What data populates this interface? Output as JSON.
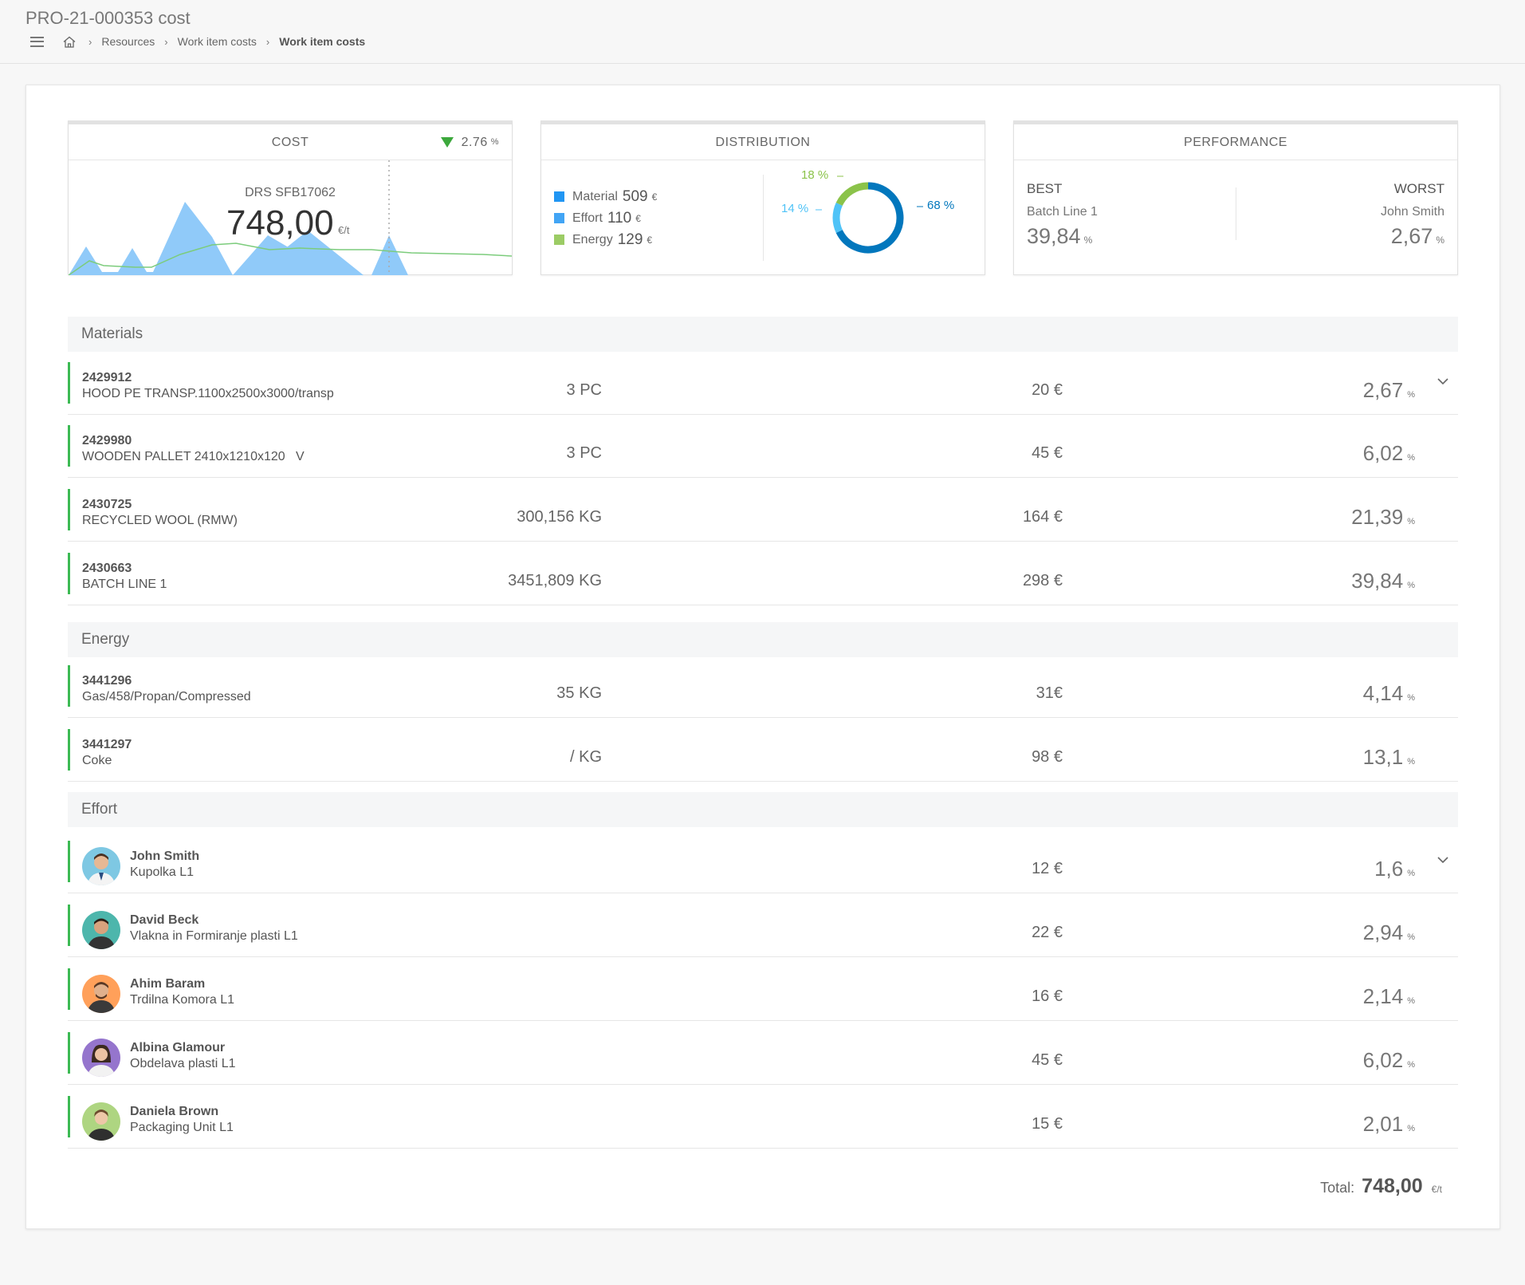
{
  "header": {
    "title": "PRO-21-000353 cost",
    "breadcrumb": [
      "Resources",
      "Work item costs",
      "Work item costs"
    ]
  },
  "cost_card": {
    "title": "COST",
    "trend_value": "2.76",
    "trend_unit": "%",
    "trend_color": "#3ca83c",
    "label": "DRS SFB17062",
    "value": "748,00",
    "unit": "€/t"
  },
  "distribution_card": {
    "title": "DISTRIBUTION",
    "items": [
      {
        "label": "Material",
        "value": "509",
        "unit": "€",
        "color": "#2196f3"
      },
      {
        "label": "Effort",
        "value": "110",
        "unit": "€",
        "color": "#42a5f5"
      },
      {
        "label": "Energy",
        "value": "129",
        "unit": "€",
        "color": "#9ccc65"
      }
    ],
    "donut": [
      {
        "label": "68 %",
        "percent": 68,
        "color": "#0277bd"
      },
      {
        "label": "14 %",
        "percent": 14,
        "color": "#4fc3f7"
      },
      {
        "label": "18 %",
        "percent": 18,
        "color": "#8bc34a"
      }
    ]
  },
  "performance_card": {
    "title": "PERFORMANCE",
    "best": {
      "title": "BEST",
      "name": "Batch Line 1",
      "value": "39,84",
      "unit": "%"
    },
    "worst": {
      "title": "WORST",
      "name": "John Smith",
      "value": "2,67",
      "unit": "%"
    }
  },
  "sections": {
    "materials": {
      "title": "Materials",
      "rows": [
        {
          "code": "2429912",
          "desc": "HOOD PE TRANSP.1100x2500x3000/transp",
          "qty": "3 PC",
          "price": "20 €",
          "pct": "2,67",
          "unit": "%"
        },
        {
          "code": "2429980",
          "desc": "WOODEN PALLET 2410x1210x120   V",
          "qty": "3 PC",
          "price": "45 €",
          "pct": "6,02",
          "unit": "%"
        },
        {
          "code": "2430725",
          "desc": "RECYCLED WOOL (RMW)",
          "qty": "300,156 KG",
          "price": "164 €",
          "pct": "21,39",
          "unit": "%"
        },
        {
          "code": "2430663",
          "desc": "BATCH LINE 1",
          "qty": "3451,809 KG",
          "price": "298 €",
          "pct": "39,84",
          "unit": "%"
        }
      ]
    },
    "energy": {
      "title": "Energy",
      "rows": [
        {
          "code": "3441296",
          "desc": "Gas/458/Propan/Compressed",
          "qty": "35 KG",
          "price": "31€",
          "pct": "4,14",
          "unit": "%"
        },
        {
          "code": "3441297",
          "desc": "Coke",
          "qty": "/ KG",
          "price": "98 €",
          "pct": "13,1",
          "unit": "%"
        }
      ]
    },
    "effort": {
      "title": "Effort",
      "rows": [
        {
          "name": "John Smith",
          "role": "Kupolka L1",
          "price": "12 €",
          "pct": "1,6",
          "unit": "%"
        },
        {
          "name": "David Beck",
          "role": "Vlakna in Formiranje plasti L1",
          "price": "22 €",
          "pct": "2,94",
          "unit": "%"
        },
        {
          "name": "Ahim Baram",
          "role": "Trdilna Komora L1",
          "price": "16 €",
          "pct": "2,14",
          "unit": "%"
        },
        {
          "name": "Albina Glamour",
          "role": "Obdelava plasti L1",
          "price": "45 €",
          "pct": "6,02",
          "unit": "%"
        },
        {
          "name": "Daniela Brown",
          "role": "Packaging Unit L1",
          "price": "15 €",
          "pct": "2,01",
          "unit": "%"
        }
      ]
    }
  },
  "total": {
    "label": "Total:",
    "value": "748,00",
    "unit": "€/t"
  }
}
